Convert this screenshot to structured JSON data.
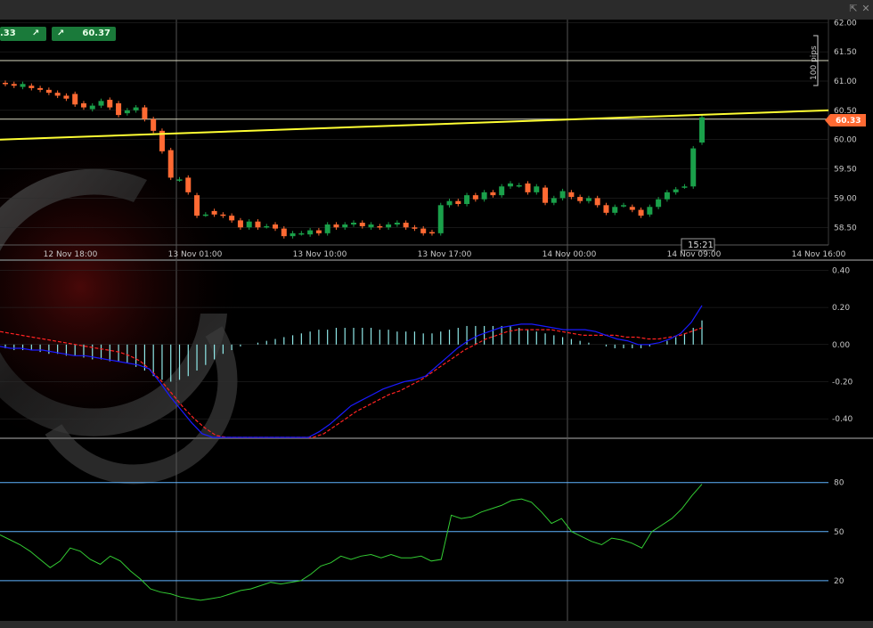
{
  "window": {
    "popout_icon": "⇱",
    "close_icon": "✕"
  },
  "price_chips": [
    {
      "value": ".33",
      "arrow": "↗"
    },
    {
      "value": "60.37",
      "arrow": "↗"
    }
  ],
  "colors": {
    "bg": "#000000",
    "grid": "#2e2e2e",
    "bull": "#1aa04a",
    "bear": "#ff6a33",
    "trend": "#ffff33",
    "macd": "#1a1aff",
    "signal": "#ff2222",
    "hist": "#8fe8e8",
    "stoch": "#33cc33",
    "level": "#5fb4ff",
    "current_price_bg": "#ff6a33"
  },
  "price_panel": {
    "y_ticks": [
      "62.00",
      "61.50",
      "61.00",
      "60.50",
      "60.00",
      "59.50",
      "59.00",
      "58.50"
    ],
    "x_ticks": [
      "12 Nov 18:00",
      "13 Nov 01:00",
      "13 Nov 10:00",
      "13 Nov 17:00",
      "14 Nov 00:00",
      "14 Nov 09:00",
      "14 Nov 16:00"
    ],
    "current_price": "60.33",
    "cursor_time": "15:21",
    "pip_ruler_label": "100 pips"
  },
  "macd_panel": {
    "y_ticks": [
      "0.40",
      "0.20",
      "0.00",
      "-0.20",
      "-0.40"
    ]
  },
  "stoch_panel": {
    "y_ticks": [
      "80",
      "50",
      "20"
    ]
  },
  "chart_data": {
    "type": "candlestick",
    "title": "",
    "xlabel": "",
    "ylabel": "",
    "x": [
      "12 Nov 18:00",
      "13 Nov 01:00",
      "13 Nov 10:00",
      "13 Nov 17:00",
      "14 Nov 00:00",
      "14 Nov 09:00",
      "14 Nov 16:00"
    ],
    "ylim": [
      58.2,
      62.05
    ],
    "horizontal_lines": [
      61.35,
      60.35
    ],
    "trend_line": [
      {
        "x_index": 0,
        "y": 60.0
      },
      {
        "x_index": 1,
        "y": 60.5
      }
    ],
    "candles": [
      {
        "o": 60.97,
        "c": 60.95
      },
      {
        "o": 60.95,
        "c": 60.92
      },
      {
        "o": 60.9,
        "c": 60.95
      },
      {
        "o": 60.92,
        "c": 60.88
      },
      {
        "o": 60.88,
        "c": 60.85
      },
      {
        "o": 60.85,
        "c": 60.8
      },
      {
        "o": 60.8,
        "c": 60.75
      },
      {
        "o": 60.75,
        "c": 60.7
      },
      {
        "o": 60.78,
        "c": 60.6
      },
      {
        "o": 60.62,
        "c": 60.55
      },
      {
        "o": 60.52,
        "c": 60.58
      },
      {
        "o": 60.58,
        "c": 60.66
      },
      {
        "o": 60.68,
        "c": 60.55
      },
      {
        "o": 60.62,
        "c": 60.42
      },
      {
        "o": 60.45,
        "c": 60.5
      },
      {
        "o": 60.5,
        "c": 60.55
      },
      {
        "o": 60.55,
        "c": 60.35
      },
      {
        "o": 60.35,
        "c": 60.15
      },
      {
        "o": 60.15,
        "c": 59.8
      },
      {
        "o": 59.82,
        "c": 59.35
      },
      {
        "o": 59.32,
        "c": 59.32
      },
      {
        "o": 59.35,
        "c": 59.1
      },
      {
        "o": 59.05,
        "c": 58.7
      },
      {
        "o": 58.72,
        "c": 58.72
      },
      {
        "o": 58.78,
        "c": 58.72
      },
      {
        "o": 58.72,
        "c": 58.7
      },
      {
        "o": 58.7,
        "c": 58.62
      },
      {
        "o": 58.62,
        "c": 58.5
      },
      {
        "o": 58.5,
        "c": 58.6
      },
      {
        "o": 58.6,
        "c": 58.5
      },
      {
        "o": 58.52,
        "c": 58.52
      },
      {
        "o": 58.55,
        "c": 58.48
      },
      {
        "o": 58.48,
        "c": 58.35
      },
      {
        "o": 58.35,
        "c": 58.4
      },
      {
        "o": 58.4,
        "c": 58.4
      },
      {
        "o": 58.38,
        "c": 58.45
      },
      {
        "o": 58.45,
        "c": 58.4
      },
      {
        "o": 58.4,
        "c": 58.55
      },
      {
        "o": 58.55,
        "c": 58.5
      },
      {
        "o": 58.5,
        "c": 58.55
      },
      {
        "o": 58.55,
        "c": 58.58
      },
      {
        "o": 58.58,
        "c": 58.52
      },
      {
        "o": 58.5,
        "c": 58.55
      },
      {
        "o": 58.52,
        "c": 58.5
      },
      {
        "o": 58.5,
        "c": 58.55
      },
      {
        "o": 58.55,
        "c": 58.58
      },
      {
        "o": 58.58,
        "c": 58.5
      },
      {
        "o": 58.5,
        "c": 58.48
      },
      {
        "o": 58.48,
        "c": 58.4
      },
      {
        "o": 58.42,
        "c": 58.4
      },
      {
        "o": 58.4,
        "c": 58.88
      },
      {
        "o": 58.88,
        "c": 58.95
      },
      {
        "o": 58.95,
        "c": 58.9
      },
      {
        "o": 58.9,
        "c": 59.05
      },
      {
        "o": 59.05,
        "c": 58.98
      },
      {
        "o": 58.98,
        "c": 59.1
      },
      {
        "o": 59.1,
        "c": 59.05
      },
      {
        "o": 59.05,
        "c": 59.2
      },
      {
        "o": 59.2,
        "c": 59.25
      },
      {
        "o": 59.22,
        "c": 59.22
      },
      {
        "o": 59.25,
        "c": 59.1
      },
      {
        "o": 59.1,
        "c": 59.2
      },
      {
        "o": 59.18,
        "c": 58.92
      },
      {
        "o": 58.92,
        "c": 59.0
      },
      {
        "o": 59.0,
        "c": 59.12
      },
      {
        "o": 59.1,
        "c": 59.02
      },
      {
        "o": 59.02,
        "c": 58.95
      },
      {
        "o": 58.95,
        "c": 59.0
      },
      {
        "o": 59.0,
        "c": 58.88
      },
      {
        "o": 58.88,
        "c": 58.75
      },
      {
        "o": 58.75,
        "c": 58.85
      },
      {
        "o": 58.88,
        "c": 58.88
      },
      {
        "o": 58.85,
        "c": 58.8
      },
      {
        "o": 58.8,
        "c": 58.7
      },
      {
        "o": 58.72,
        "c": 58.85
      },
      {
        "o": 58.85,
        "c": 58.98
      },
      {
        "o": 58.98,
        "c": 59.1
      },
      {
        "o": 59.1,
        "c": 59.15
      },
      {
        "o": 59.2,
        "c": 59.2
      },
      {
        "o": 59.2,
        "c": 59.85
      },
      {
        "o": 59.95,
        "c": 60.38
      }
    ],
    "macd_hist": [
      -0.02,
      -0.03,
      -0.03,
      -0.03,
      -0.04,
      -0.05,
      -0.05,
      -0.06,
      -0.06,
      -0.07,
      -0.08,
      -0.08,
      -0.09,
      -0.09,
      -0.1,
      -0.12,
      -0.14,
      -0.17,
      -0.19,
      -0.2,
      -0.19,
      -0.17,
      -0.14,
      -0.11,
      -0.08,
      -0.05,
      -0.03,
      -0.01,
      0.0,
      0.01,
      0.02,
      0.03,
      0.04,
      0.05,
      0.06,
      0.07,
      0.08,
      0.08,
      0.09,
      0.09,
      0.09,
      0.09,
      0.09,
      0.08,
      0.08,
      0.07,
      0.07,
      0.07,
      0.06,
      0.06,
      0.07,
      0.08,
      0.09,
      0.1,
      0.1,
      0.1,
      0.1,
      0.1,
      0.1,
      0.09,
      0.08,
      0.07,
      0.06,
      0.05,
      0.04,
      0.03,
      0.02,
      0.01,
      0.0,
      -0.01,
      -0.02,
      -0.02,
      -0.02,
      -0.02,
      -0.01,
      0.0,
      0.02,
      0.04,
      0.06,
      0.09,
      0.13
    ],
    "macd_line": [
      -0.01,
      -0.02,
      -0.02,
      -0.03,
      -0.03,
      -0.04,
      -0.05,
      -0.06,
      -0.06,
      -0.07,
      -0.08,
      -0.09,
      -0.1,
      -0.11,
      -0.13,
      -0.2,
      -0.28,
      -0.35,
      -0.42,
      -0.48,
      -0.54,
      -0.58,
      -0.62,
      -0.65,
      -0.66,
      -0.66,
      -0.65,
      -0.62,
      -0.57,
      -0.52,
      -0.47,
      -0.43,
      -0.38,
      -0.33,
      -0.3,
      -0.27,
      -0.24,
      -0.22,
      -0.2,
      -0.19,
      -0.17,
      -0.12,
      -0.07,
      -0.02,
      0.02,
      0.05,
      0.07,
      0.09,
      0.1,
      0.11,
      0.11,
      0.1,
      0.09,
      0.08,
      0.08,
      0.08,
      0.07,
      0.05,
      0.03,
      0.02,
      0.0,
      0.0,
      0.01,
      0.03,
      0.06,
      0.12,
      0.21
    ],
    "signal_line": [
      0.07,
      0.06,
      0.05,
      0.04,
      0.03,
      0.02,
      0.01,
      0.0,
      -0.01,
      -0.02,
      -0.03,
      -0.04,
      -0.06,
      -0.09,
      -0.14,
      -0.2,
      -0.27,
      -0.34,
      -0.4,
      -0.45,
      -0.49,
      -0.53,
      -0.56,
      -0.59,
      -0.6,
      -0.61,
      -0.6,
      -0.58,
      -0.55,
      -0.52,
      -0.48,
      -0.44,
      -0.4,
      -0.36,
      -0.33,
      -0.3,
      -0.27,
      -0.25,
      -0.22,
      -0.19,
      -0.15,
      -0.11,
      -0.07,
      -0.03,
      0.0,
      0.03,
      0.05,
      0.07,
      0.08,
      0.08,
      0.08,
      0.08,
      0.07,
      0.06,
      0.05,
      0.05,
      0.05,
      0.05,
      0.04,
      0.04,
      0.03,
      0.03,
      0.04,
      0.05,
      0.07,
      0.09
    ],
    "stoch": [
      48,
      45,
      42,
      38,
      33,
      28,
      32,
      40,
      38,
      33,
      30,
      35,
      32,
      26,
      21,
      15,
      13,
      12,
      10,
      9,
      8,
      9,
      10,
      12,
      14,
      15,
      17,
      19,
      18,
      19,
      20,
      24,
      29,
      31,
      35,
      33,
      35,
      36,
      34,
      36,
      34,
      34,
      35,
      32,
      33,
      60,
      58,
      59,
      62,
      64,
      66,
      69,
      70,
      68,
      62,
      55,
      58,
      50,
      47,
      44,
      42,
      46,
      45,
      43,
      40,
      50,
      54,
      58,
      64,
      72,
      79
    ],
    "stoch_levels": [
      80,
      50,
      20
    ],
    "macd_range": [
      -0.5,
      0.45
    ],
    "stoch_range": [
      0,
      100
    ]
  }
}
